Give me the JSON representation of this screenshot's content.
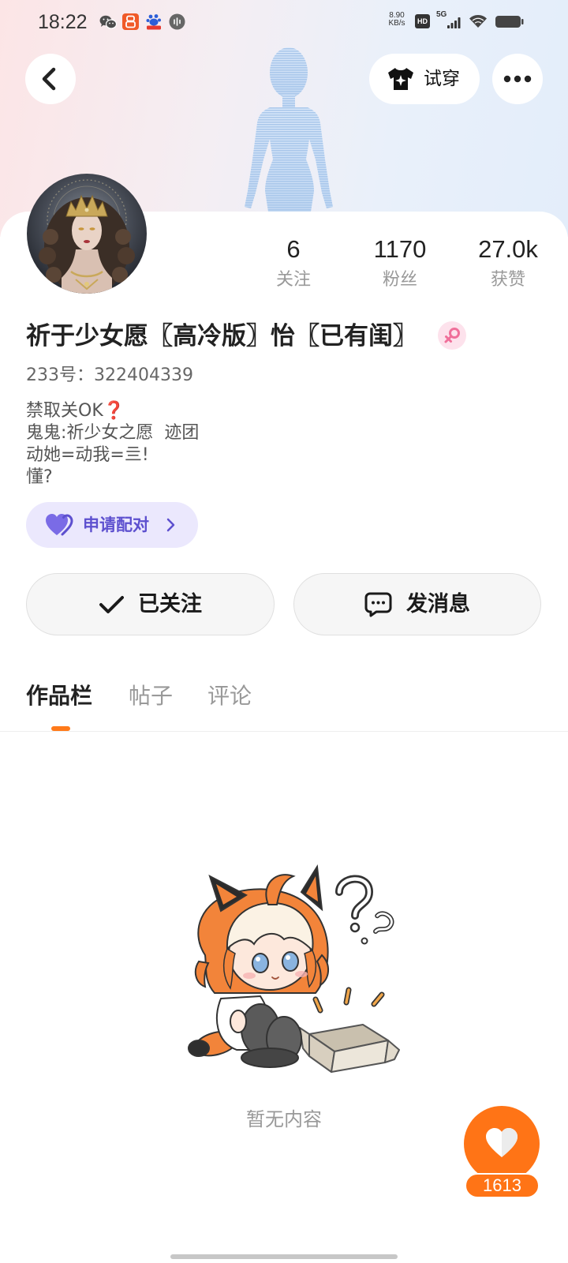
{
  "status_bar": {
    "time": "18:22",
    "notification_icons": [
      "wechat-icon",
      "orange-app-icon",
      "baidu-icon",
      "voice-app-icon"
    ],
    "net_speed_value": "8.90",
    "net_speed_unit": "KB/s",
    "hd_label": "HD",
    "network_type": "5G",
    "signal_icon": "signal-bars-icon",
    "wifi_icon": "wifi-icon",
    "battery_icon": "battery-icon"
  },
  "header": {
    "back_icon": "back-arrow-icon",
    "avatar_preview": "hologram-avatar-figure",
    "try_on": {
      "icon": "tshirt-icon",
      "label": "试穿"
    },
    "more_icon": "more-dots-icon"
  },
  "profile": {
    "avatar": "profile-avatar-image",
    "stats": [
      {
        "value": "6",
        "label": "关注"
      },
      {
        "value": "1170",
        "label": "粉丝"
      },
      {
        "value": "27.0k",
        "label": "获赞"
      }
    ],
    "name": "祈于少女愿〖高冷版〗怡〖已有闺〗",
    "gender_icon": "female-icon",
    "id_text": "233号：322404339",
    "bio": {
      "line1": "禁取关OK",
      "line1_emoji": "❓",
      "line2": "鬼鬼:祈少女之愿  迹团",
      "line3": "动她=动我=亖!",
      "line4": "懂?"
    },
    "pair_button": {
      "icon": "heart-pair-icon",
      "label": "申请配对",
      "chevron": "chevron-right-icon"
    }
  },
  "actions": {
    "follow": {
      "icon": "check-icon",
      "label": "已关注"
    },
    "message": {
      "icon": "chat-bubble-icon",
      "label": "发消息"
    }
  },
  "tabs": [
    {
      "label": "作品栏",
      "active": true
    },
    {
      "label": "帖子",
      "active": false
    },
    {
      "label": "评论",
      "active": false
    }
  ],
  "empty_state": {
    "text": "暂无内容",
    "illustration": "empty-box-mascot-illustration"
  },
  "like_button": {
    "icon": "heart-icon",
    "count": "1613"
  },
  "colors": {
    "accent": "#ff7a1a",
    "pair-purple": "#5d50cf",
    "pair-bg": "#ebe8fd",
    "female-pink": "#f0709a",
    "female-bg": "#fde2ec",
    "text-primary": "#222222",
    "text-secondary": "#999999"
  }
}
